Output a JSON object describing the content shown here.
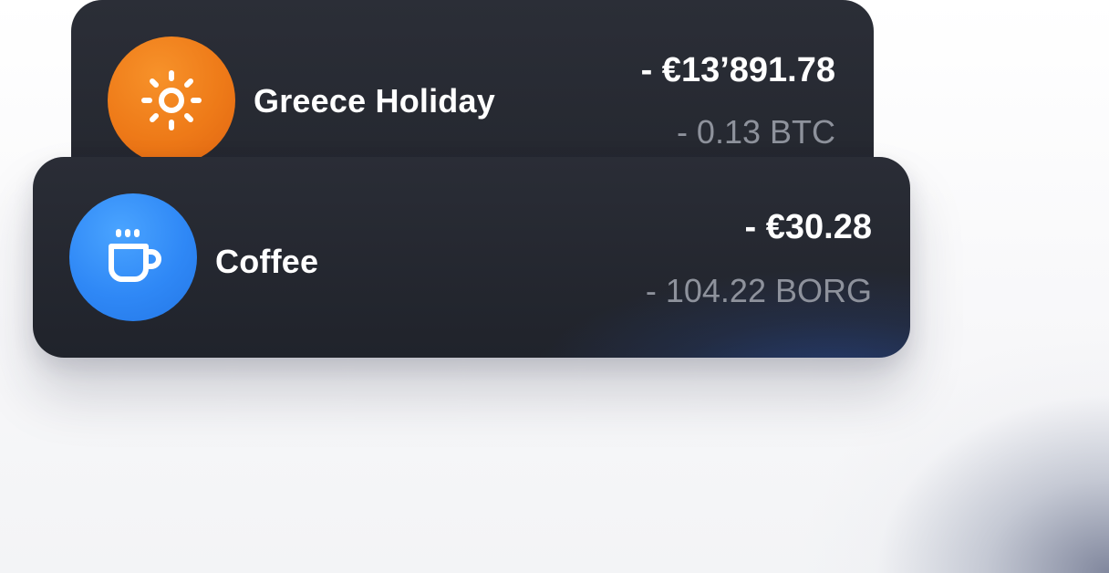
{
  "transactions": [
    {
      "title": "Greece Holiday",
      "amount": "- €13’891.78",
      "crypto": "- 0.13 BTC",
      "icon": "sun-icon",
      "icon_color": "#ee7a18"
    },
    {
      "title": "Coffee",
      "amount": "- €30.28",
      "crypto": "- 104.22 BORG",
      "icon": "coffee-cup-icon",
      "icon_color": "#2f88f6"
    }
  ],
  "colors": {
    "card_background": "#24272f",
    "primary_text": "#ffffff",
    "secondary_text": "#8e929c"
  }
}
